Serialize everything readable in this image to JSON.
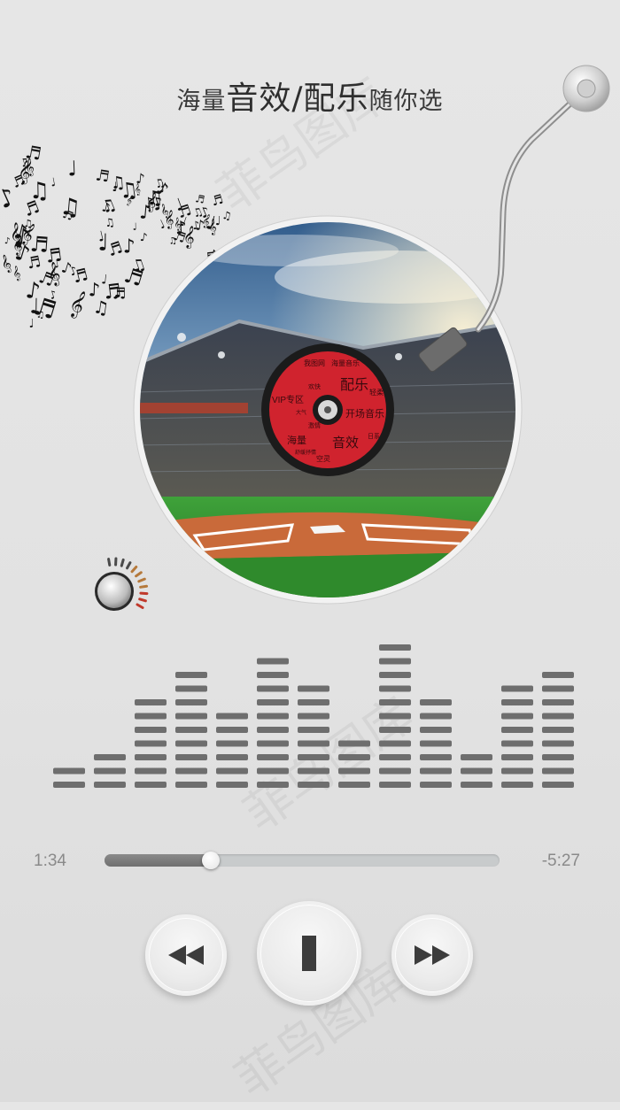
{
  "header": {
    "title_part1": "海量",
    "title_part2": "音效/配乐",
    "title_part3": "随你选"
  },
  "record": {
    "label_texts": [
      "我图网",
      "海量音乐",
      "配乐",
      "轻柔",
      "VIP专区",
      "大气",
      "激情",
      "开场音乐",
      "音效",
      "海量",
      "空灵",
      "舒缓抒情",
      "日系",
      "欢快"
    ],
    "label_color": "#d0232e"
  },
  "equalizer": {
    "levels": [
      2,
      3,
      7,
      9,
      6,
      10,
      8,
      4,
      11,
      7,
      3,
      8,
      9
    ],
    "bar_color": "#6e6e6e"
  },
  "player": {
    "elapsed": "1:34",
    "remaining": "-5:27",
    "progress": 0.27
  },
  "controls": {
    "rewind_icon": "rewind-icon",
    "play_pause_icon": "pause-icon",
    "forward_icon": "fast-forward-icon"
  },
  "watermark": {
    "text": "菲鸟图库"
  },
  "colors": {
    "accent": "#d0232e",
    "bar": "#6e6e6e",
    "background": "#e4e4e4"
  }
}
